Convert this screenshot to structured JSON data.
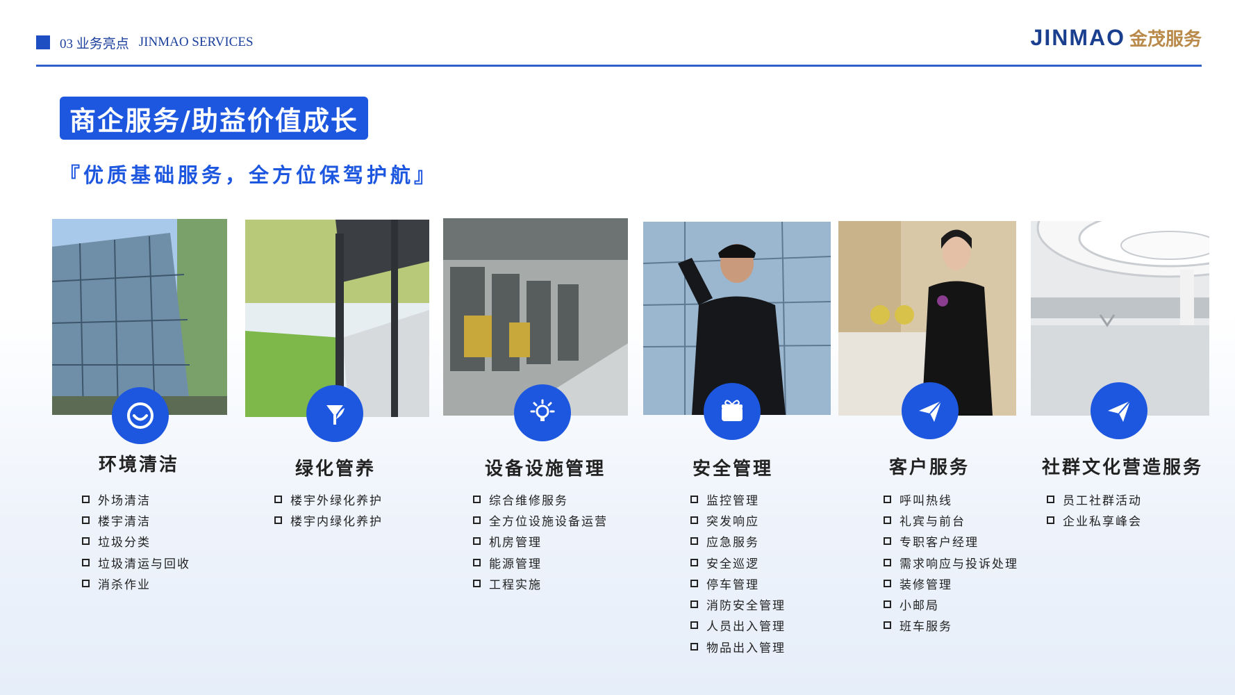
{
  "header": {
    "section": "03 业务亮点",
    "en": "JINMAO SERVICES"
  },
  "logo": {
    "en": "JINMAO",
    "cn": "金茂服务"
  },
  "title": "商企服务/助益价值成长",
  "subtitle": "『优质基础服务，全方位保驾护航』",
  "colors": {
    "accent": "#1d57e0",
    "gold": "#b98a4a",
    "navy": "#1a3f8f"
  },
  "cards": [
    {
      "name": "环境清洁",
      "icon": "smile-icon",
      "items": [
        "外场清洁",
        "楼宇清洁",
        "垃圾分类",
        "垃圾清运与回收",
        "消杀作业"
      ]
    },
    {
      "name": "绿化管养",
      "icon": "plant-icon",
      "items": [
        "楼宇外绿化养护",
        "楼宇内绿化养护"
      ]
    },
    {
      "name": "设备设施管理",
      "icon": "lightbulb-icon",
      "items": [
        "综合维修服务",
        "全方位设施设备运营",
        "机房管理",
        "能源管理",
        "工程实施"
      ]
    },
    {
      "name": "安全管理",
      "icon": "gift-box-icon",
      "items": [
        "监控管理",
        "突发响应",
        "应急服务",
        "安全巡逻",
        "停车管理",
        "消防安全管理",
        "人员出入管理",
        "物品出入管理"
      ]
    },
    {
      "name": "客户服务",
      "icon": "paper-plane-icon",
      "items": [
        "呼叫热线",
        "礼宾与前台",
        "专职客户经理",
        "需求响应与投诉处理",
        "装修管理",
        "小邮局",
        "班车服务"
      ]
    },
    {
      "name": "社群文化营造服务",
      "icon": "paper-plane-icon",
      "items": [
        "员工社群活动",
        "企业私享峰会"
      ]
    }
  ]
}
